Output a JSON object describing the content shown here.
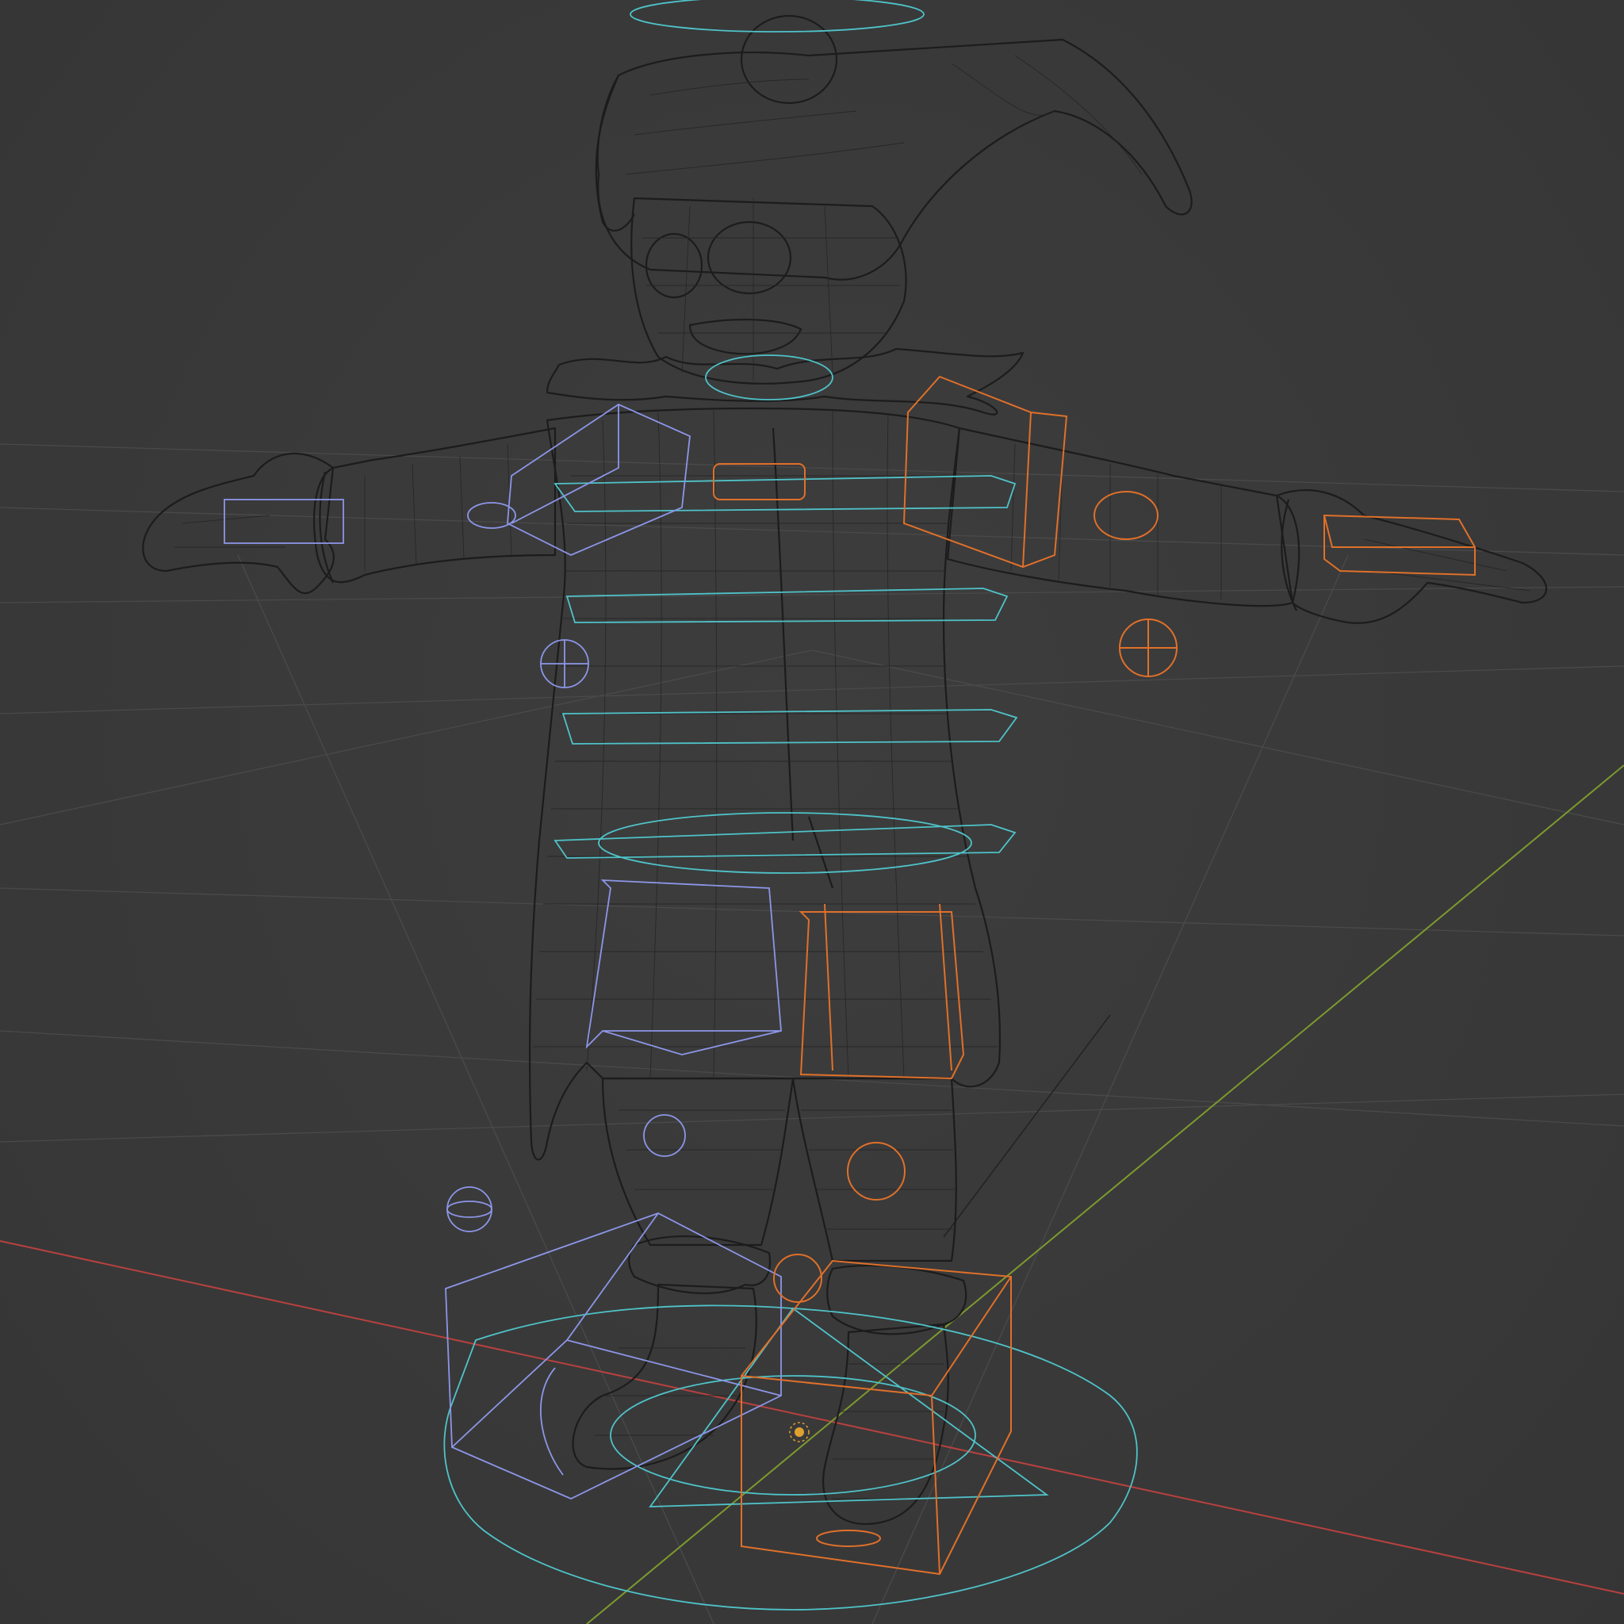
{
  "viewport": {
    "shading_mode": "wireframe",
    "colors": {
      "background": "#3a3a3a",
      "grid": "#4a4a4a",
      "x_axis": "#b8413f",
      "y_axis": "#7d9a2e",
      "mesh_wire": "#1c1c1c",
      "control_center": "#4fc3c9",
      "control_left": "#8c96e8",
      "control_right": "#e0702a"
    },
    "objects": [
      {
        "name": "character-mesh",
        "type": "mesh"
      },
      {
        "name": "armature-rig",
        "type": "controls"
      }
    ]
  }
}
